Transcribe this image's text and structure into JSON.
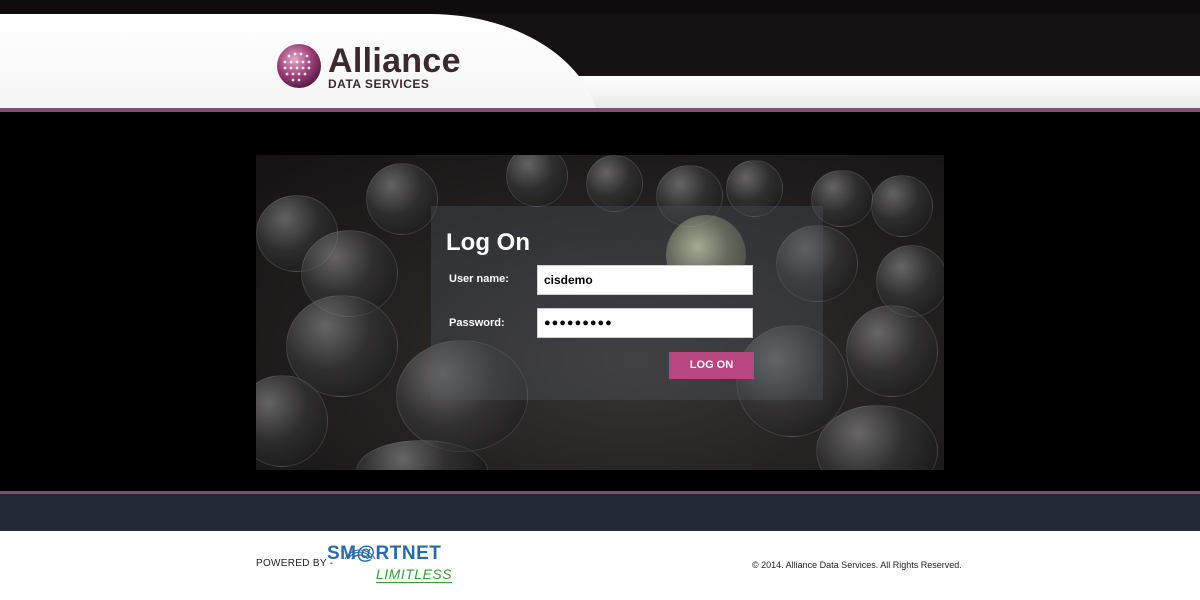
{
  "brand": {
    "name": "Alliance",
    "sub": "DATA SERVICES"
  },
  "login": {
    "title": "Log On",
    "username_label": "User name:",
    "username_value": "cisdemo",
    "password_label": "Password:",
    "password_value": "●●●●●●●●●",
    "button_label": "LOG ON"
  },
  "footer": {
    "powered_by": "POWERED BY -",
    "smartnet_brand": "SM@RTNET",
    "smartnet_tagline": "LIMITLESS",
    "copyright": "© 2014. Alliance Data Services. All Rights Reserved."
  },
  "colors": {
    "accent": "#b9477f",
    "header_line": "#8a4a77",
    "band": "#232a35"
  },
  "icons": [
    "alliance-globe-logo-icon",
    "smartnet-signal-icon"
  ]
}
